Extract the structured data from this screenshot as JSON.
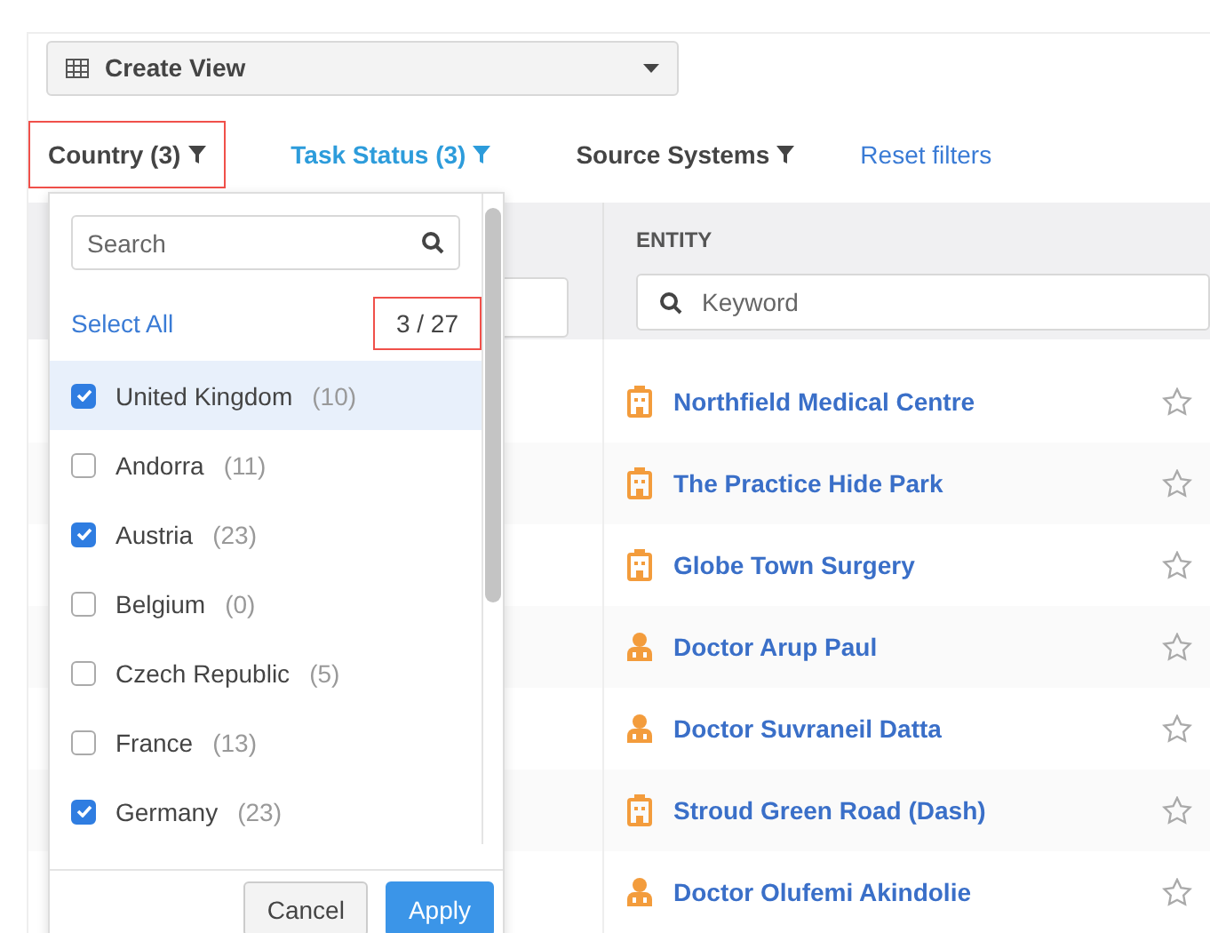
{
  "view_selector": {
    "label": "Create View"
  },
  "filters": [
    {
      "label": "Country (3)",
      "active": false,
      "highlighted": true
    },
    {
      "label": "Task Status (3)",
      "active": true,
      "highlighted": false
    },
    {
      "label": "Source Systems",
      "active": false,
      "highlighted": false
    }
  ],
  "reset_link": "Reset filters",
  "table": {
    "columns": [
      {
        "header": "ENTITY",
        "placeholder": "Keyword"
      }
    ],
    "rows": [
      {
        "kind": "building",
        "name": "Northfield Medical Centre",
        "starred": false
      },
      {
        "kind": "building",
        "name": "The Practice Hide Park",
        "starred": false
      },
      {
        "kind": "building",
        "name": "Globe Town Surgery",
        "starred": false
      },
      {
        "kind": "doctor",
        "name": "Doctor Arup Paul",
        "starred": false
      },
      {
        "kind": "doctor",
        "name": "Doctor Suvraneil Datta",
        "starred": false
      },
      {
        "kind": "building",
        "name": "Stroud Green Road (Dash)",
        "starred": false
      },
      {
        "kind": "doctor",
        "name": "Doctor Olufemi Akindolie",
        "starred": false
      }
    ]
  },
  "country_dropdown": {
    "search_placeholder": "Search",
    "select_all": "Select All",
    "counter": {
      "text": "3 / 27",
      "highlighted": true
    },
    "options": [
      {
        "label": "United Kingdom",
        "count": "(10)",
        "checked": true,
        "selected": true
      },
      {
        "label": "Andorra",
        "count": "(11)",
        "checked": false,
        "selected": false
      },
      {
        "label": "Austria",
        "count": "(23)",
        "checked": true,
        "selected": false
      },
      {
        "label": "Belgium",
        "count": "(0)",
        "checked": false,
        "selected": false
      },
      {
        "label": "Czech Republic",
        "count": "(5)",
        "checked": false,
        "selected": false
      },
      {
        "label": "France",
        "count": "(13)",
        "checked": false,
        "selected": false
      },
      {
        "label": "Germany",
        "count": "(23)",
        "checked": true,
        "selected": false
      }
    ],
    "buttons": [
      {
        "kind": "secondary",
        "label": "Cancel"
      },
      {
        "kind": "primary",
        "label": "Apply"
      }
    ]
  }
}
